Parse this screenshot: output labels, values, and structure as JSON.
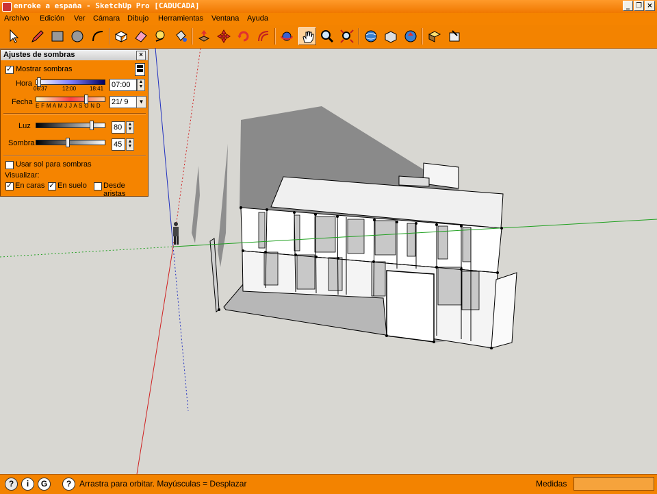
{
  "window": {
    "title": "enroke a españa - SketchUp Pro [CADUCADA]",
    "minimize_glyph": "_",
    "restore_glyph": "❐",
    "close_glyph": "×"
  },
  "menu": [
    "Archivo",
    "Edición",
    "Ver",
    "Cámara",
    "Dibujo",
    "Herramientas",
    "Ventana",
    "Ayuda"
  ],
  "toolbar": {
    "tools": [
      "select-arrow-icon",
      "pencil-line-icon",
      "rectangle-icon",
      "circle-icon",
      "arc-icon",
      "make-component-icon",
      "eraser-icon",
      "tape-measure-icon",
      "paint-bucket-icon",
      "push-pull-icon",
      "move-icon",
      "rotate-icon",
      "offset-icon",
      "orbit-icon",
      "pan-hand-icon",
      "zoom-icon",
      "zoom-extents-icon",
      "get-models-icon",
      "share-model-icon",
      "upload-icon",
      "components-icon",
      "materials-icon"
    ],
    "active_tool": "orbit-icon"
  },
  "shadow_panel": {
    "title": "Ajustes de sombras",
    "close_glyph": "×",
    "show_shadows_label": "Mostrar sombras",
    "show_shadows": true,
    "hora_label": "Hora",
    "hora_start": "06:37",
    "hora_mid": "12:00",
    "hora_end": "18:41",
    "hora_value": "07:00",
    "fecha_label": "Fecha",
    "fecha_months": "E F M A M J  J  A S O N D",
    "fecha_value": "21/ 9",
    "luz_label": "Luz",
    "luz_value": "80",
    "luz_level": 0.8,
    "sombra_label": "Sombra",
    "sombra_value": "45",
    "sombra_level": 0.45,
    "use_sun_label": "Usar sol para sombras",
    "use_sun": false,
    "visualizar_label": "Visualizar:",
    "en_caras_label": "En caras",
    "en_caras": true,
    "en_suelo_label": "En suelo",
    "en_suelo": true,
    "desde_aristas_label": "Desde aristas",
    "desde_aristas": false
  },
  "status": {
    "message": "Arrastra para orbitar. Mayúsculas = Desplazar",
    "measures_label": "Medidas",
    "measures_value": ""
  },
  "colors": {
    "accent": "#f58400",
    "background": "#d8d7d2",
    "axis_red": "#d02020",
    "axis_green": "#20a020",
    "axis_blue": "#2030c0",
    "shadow": "#8a8a8a"
  }
}
